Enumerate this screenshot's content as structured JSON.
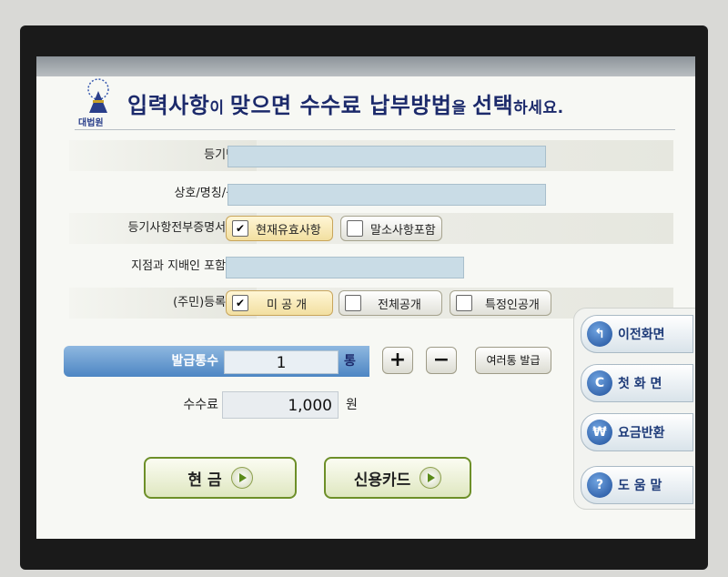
{
  "header": {
    "logo_text": "대법원",
    "title_parts": [
      "입력사항",
      "이 ",
      "맞으면",
      " ",
      "수수료",
      " ",
      "납부방법",
      "을 ",
      "선택",
      "하세요."
    ]
  },
  "form": {
    "registration_number_label": "등기번호",
    "business_name_label": "상호/명칭/성명",
    "certificate_type_label": "등기사항전부증명서종류",
    "certificate_options": [
      {
        "label": "현재유효사항",
        "checked": true
      },
      {
        "label": "말소사항포함",
        "checked": false
      }
    ],
    "branch_label": "지점과 지배인 포함여부",
    "resident_number_label": "(주민)등록번호",
    "disclosure_options": [
      {
        "label": "미 공 개",
        "checked": true
      },
      {
        "label": "전체공개",
        "checked": false
      },
      {
        "label": "특정인공개",
        "checked": false
      }
    ]
  },
  "copies": {
    "label": "발급통수",
    "value": "1",
    "unit": "통",
    "plus": "+",
    "minus": "−",
    "multi_label": "여러통 발급"
  },
  "fee": {
    "label": "수수료",
    "value": "1,000",
    "unit": "원"
  },
  "payment": {
    "cash_label": "현 금",
    "card_label": "신용카드"
  },
  "side_nav": {
    "items": [
      {
        "label": "이전화면",
        "icon": "back-arrow-icon",
        "glyph": "↰"
      },
      {
        "label": "첫 화 면",
        "icon": "home-c-icon",
        "glyph": "C"
      },
      {
        "label": "요금반환",
        "icon": "won-icon",
        "glyph": "₩"
      },
      {
        "label": "도 움 말",
        "icon": "help-icon",
        "glyph": "?"
      }
    ]
  },
  "colors": {
    "title": "#1c2a6b",
    "accent_blue": "#4d86c3",
    "pay_border": "#6d8f28"
  }
}
